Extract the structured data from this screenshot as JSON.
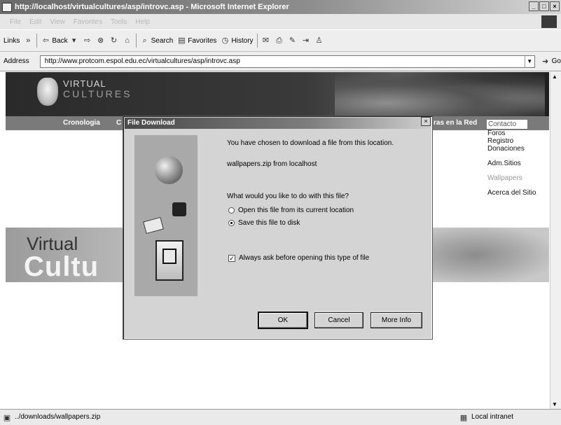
{
  "window": {
    "title": "http://localhost/virtualcultures/asp/introvc.asp - Microsoft Internet Explorer",
    "controls": [
      "_",
      "□",
      "×"
    ]
  },
  "menu": [
    "File",
    "Edit",
    "View",
    "Favorites",
    "Tools",
    "Help"
  ],
  "toolbar": {
    "links": "Links",
    "back": "Back",
    "search": "Search",
    "favorites": "Favorites",
    "history": "History"
  },
  "address": {
    "label": "Address",
    "url": "http://www.protcom.espol.edu.ec/virtualcultures/asp/introvc.asp",
    "go": "Go"
  },
  "site": {
    "logo_line1": "VIRTUAL",
    "logo_line2": "CULTURES",
    "nav": [
      "Cronologia",
      "C",
      "ras en la Red"
    ],
    "side_menu": [
      "Contacto",
      "Foros",
      "Registro",
      "Donaciones",
      "Adm.Sitios",
      "Wallpapers",
      "Acerca del Sitio"
    ],
    "big_word1": "Virtual",
    "big_word2": "Cultu"
  },
  "dialog": {
    "title": "File Download",
    "close": "×",
    "line1": "You have chosen to download a file from this location.",
    "line2": "wallpapers.zip from localhost",
    "question": "What would you like to do with this file?",
    "option_open": "Open this file from its current location",
    "option_save": "Save this file to disk",
    "selected_option": "save",
    "always_ask": "Always ask before opening this type of file",
    "always_ask_checked": true,
    "buttons": {
      "ok": "OK",
      "cancel": "Cancel",
      "more_info": "More Info"
    }
  },
  "status": {
    "left": "../downloads/wallpapers.zip",
    "right": "Local intranet"
  }
}
